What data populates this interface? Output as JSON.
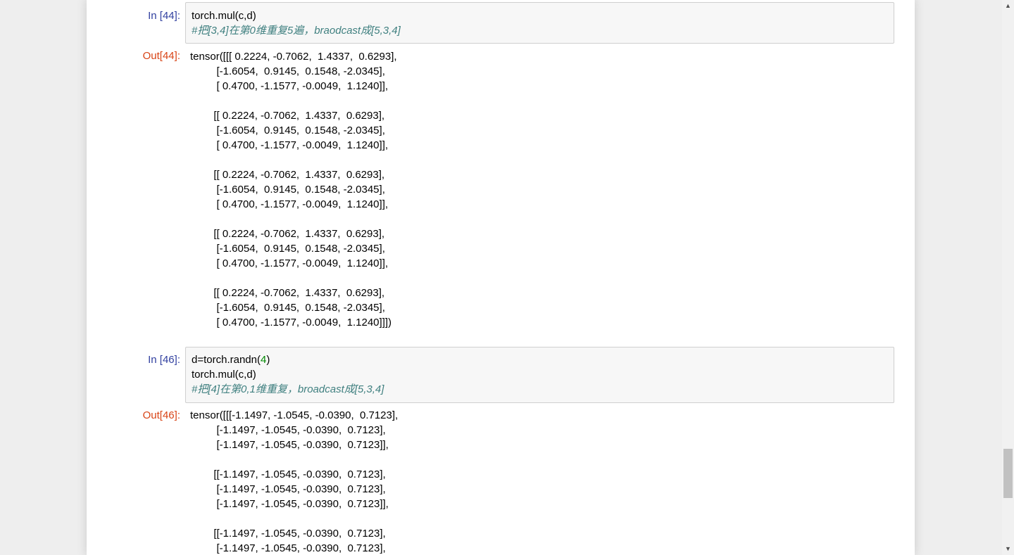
{
  "cells": [
    {
      "in_prompt": "In [44]:",
      "code": [
        "torch.mul(c,d)",
        "#把[3,4]在第0维重复5遍，braodcast成[5,3,4]"
      ],
      "out_prompt": "Out[44]:",
      "output": [
        "tensor([[[ 0.2224, -0.7062,  1.4337,  0.6293],",
        "         [-1.6054,  0.9145,  0.1548, -2.0345],",
        "         [ 0.4700, -1.1577, -0.0049,  1.1240]],",
        "",
        "        [[ 0.2224, -0.7062,  1.4337,  0.6293],",
        "         [-1.6054,  0.9145,  0.1548, -2.0345],",
        "         [ 0.4700, -1.1577, -0.0049,  1.1240]],",
        "",
        "        [[ 0.2224, -0.7062,  1.4337,  0.6293],",
        "         [-1.6054,  0.9145,  0.1548, -2.0345],",
        "         [ 0.4700, -1.1577, -0.0049,  1.1240]],",
        "",
        "        [[ 0.2224, -0.7062,  1.4337,  0.6293],",
        "         [-1.6054,  0.9145,  0.1548, -2.0345],",
        "         [ 0.4700, -1.1577, -0.0049,  1.1240]],",
        "",
        "        [[ 0.2224, -0.7062,  1.4337,  0.6293],",
        "         [-1.6054,  0.9145,  0.1548, -2.0345],",
        "         [ 0.4700, -1.1577, -0.0049,  1.1240]]])"
      ]
    },
    {
      "in_prompt": "In [46]:",
      "code_line_1_pre": "d=torch.randn(",
      "code_line_1_num": "4",
      "code_line_1_post": ")",
      "code": [
        "torch.mul(c,d)",
        "#把[4]在第0,1维重复，broadcast成[5,3,4]"
      ],
      "out_prompt": "Out[46]:",
      "output": [
        "tensor([[[-1.1497, -1.0545, -0.0390,  0.7123],",
        "         [-1.1497, -1.0545, -0.0390,  0.7123],",
        "         [-1.1497, -1.0545, -0.0390,  0.7123]],",
        "",
        "        [[-1.1497, -1.0545, -0.0390,  0.7123],",
        "         [-1.1497, -1.0545, -0.0390,  0.7123],",
        "         [-1.1497, -1.0545, -0.0390,  0.7123]],",
        "",
        "        [[-1.1497, -1.0545, -0.0390,  0.7123],",
        "         [-1.1497, -1.0545, -0.0390,  0.7123],"
      ]
    }
  ],
  "scrollbar": {
    "up_arrow": "▲",
    "down_arrow": "▼"
  }
}
